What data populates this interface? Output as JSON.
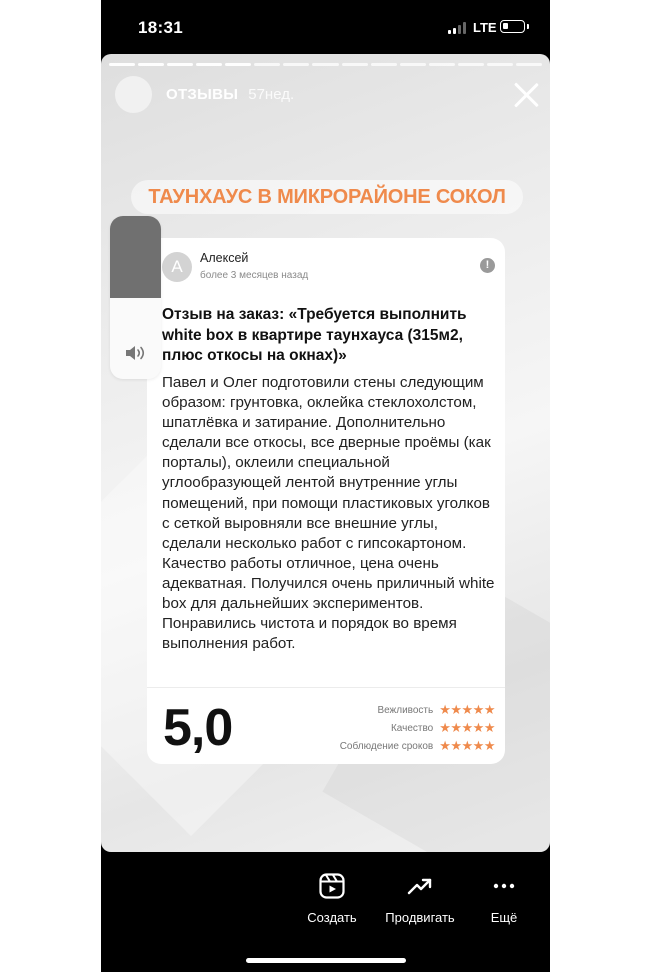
{
  "status_bar": {
    "time": "18:31",
    "network": "LTE"
  },
  "story": {
    "account_name": "ОТЗЫВЫ",
    "posted_ago": "57нед.",
    "headline": "ТАУНХАУС В МИКРОРАЙОНЕ СОКОЛ"
  },
  "review": {
    "avatar_letter": "А",
    "author": "Алексей",
    "date": "более 3 месяцев назад",
    "alert_symbol": "!",
    "title": "Отзыв на заказ: «Требуется выполнить white box в квартире таунхауса (315м2, плюс откосы на окнах)»",
    "body": "Павел и Олег подготовили стены следующим образом: грунтовка, оклейка стеклохолстом, шпатлёвка и затирание. Дополнительно сделали все откосы, все дверные проёмы (как порталы), оклеили специальной углообразующей лентой внутренние углы помещений, при помощи пластиковых уголков с сеткой выровняли все внешние углы, сделали несколько работ с гипсокартоном. Качество работы отличное, цена очень адекватная. Получился очень приличный white box для дальнейших экспериментов. Понравились чистота и порядок во время выполнения работ.",
    "score": "5,0",
    "ratings": [
      {
        "label": "Вежливость",
        "stars": "★★★★★",
        "value": 5
      },
      {
        "label": "Качество",
        "stars": "★★★★★",
        "value": 5
      },
      {
        "label": "Соблюдение сроков",
        "stars": "★★★★★",
        "value": 5
      }
    ]
  },
  "volume": {
    "level": 0.5
  },
  "bottom_bar": {
    "create_label": "Создать",
    "promote_label": "Продвигать",
    "more_label": "Ещё"
  },
  "colors": {
    "accent": "#ef8a4c",
    "background": "#000000"
  }
}
